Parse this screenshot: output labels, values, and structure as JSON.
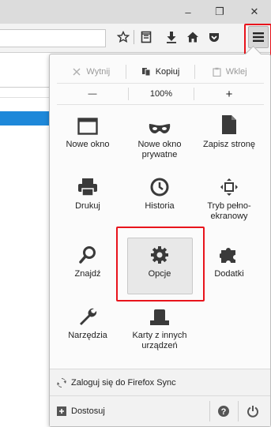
{
  "window": {
    "minimize": "–",
    "restore": "❐",
    "close": "✕"
  },
  "toolbar": {
    "icons": [
      "star-icon",
      "reading-list-icon",
      "download-icon",
      "home-icon",
      "pocket-icon",
      "menu-icon"
    ]
  },
  "menu": {
    "edit": {
      "cut": "Wytnij",
      "copy": "Kopiuj",
      "paste": "Wklej"
    },
    "zoom": {
      "out": "—",
      "level": "100%",
      "in": "+"
    },
    "items": [
      {
        "label": "Nowe okno"
      },
      {
        "label": "Nowe okno prywatne"
      },
      {
        "label": "Zapisz stronę"
      },
      {
        "label": "Drukuj"
      },
      {
        "label": "Historia"
      },
      {
        "label": "Tryb pełno-ekranowy"
      },
      {
        "label": "Znajdź"
      },
      {
        "label": "Opcje"
      },
      {
        "label": "Dodatki"
      },
      {
        "label": "Narzędzia"
      },
      {
        "label": "Karty z innych urządzeń"
      }
    ],
    "sync": "Zaloguj się do Firefox Sync",
    "customize": "Dostosuj"
  },
  "colors": {
    "highlight": "#e8141c",
    "accent": "#1e88d9"
  }
}
